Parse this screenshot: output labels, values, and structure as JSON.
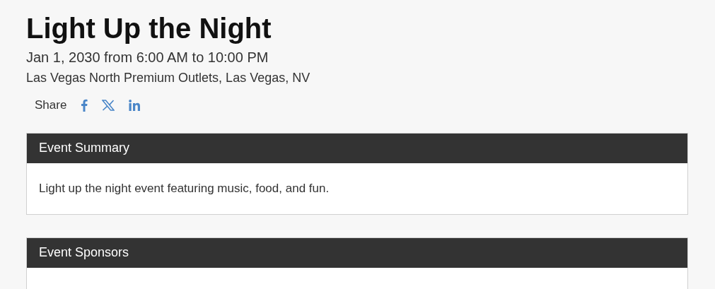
{
  "event": {
    "title": "Light Up the Night",
    "date": "Jan 1, 2030 from 6:00 AM to 10:00 PM",
    "location": "Las Vegas North Premium Outlets, Las Vegas, NV"
  },
  "share": {
    "label": "Share"
  },
  "sections": [
    {
      "heading": "Event Summary",
      "body": "Light up the night event featuring music, food, and fun."
    },
    {
      "heading": "Event Sponsors"
    }
  ]
}
